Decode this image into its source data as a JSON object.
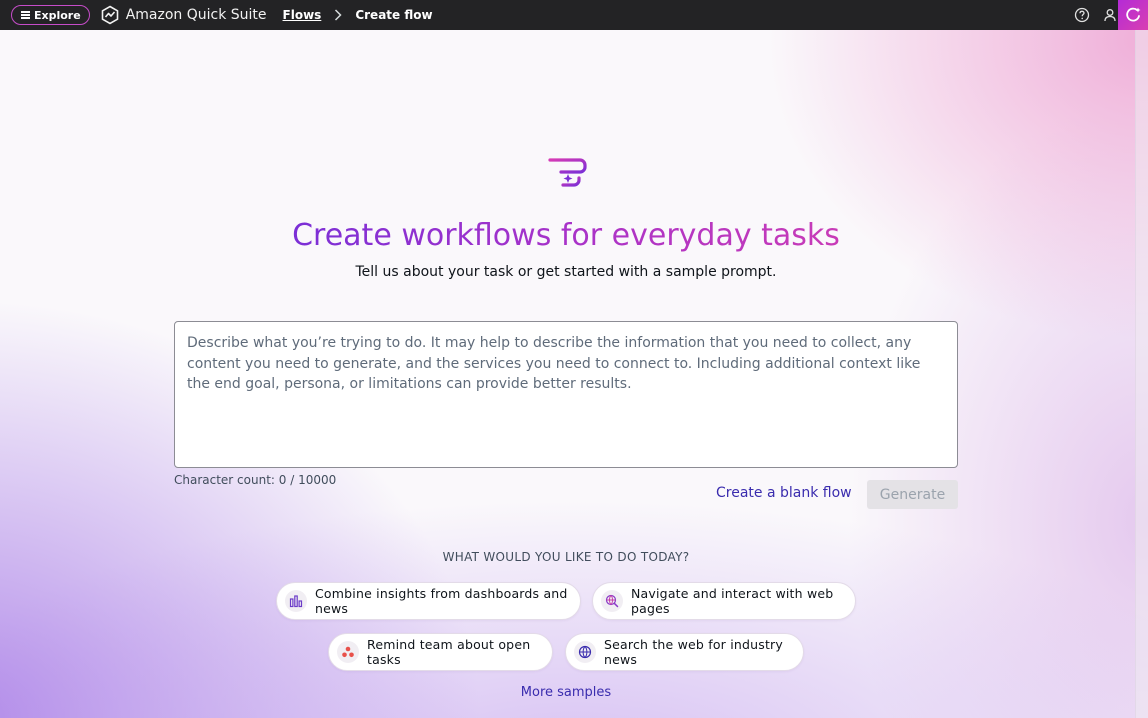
{
  "topbar": {
    "explore_label": "Explore",
    "app_name": "Amazon Quick Suite",
    "breadcrumb": {
      "parent": "Flows",
      "current": "Create flow"
    }
  },
  "hero": {
    "title": "Create workflows for everyday tasks",
    "subtitle": "Tell us about your task or get started with a sample prompt."
  },
  "prompt": {
    "placeholder": "Describe what you’re trying to do. It may help to describe the information that you need to collect, any content you need to generate, and the services you need to connect to. Including additional context like the end goal, persona, or limitations can provide better results.",
    "value": "",
    "char_count": "Character count: 0 / 10000"
  },
  "actions": {
    "blank_flow": "Create a blank flow",
    "generate": "Generate"
  },
  "samples": {
    "heading": "WHAT WOULD YOU LIKE TO DO TODAY?",
    "items": [
      {
        "label": "Combine insights from dashboards and news",
        "icon": "bar-chart-icon"
      },
      {
        "label": "Navigate and interact with web pages",
        "icon": "web-search-icon"
      },
      {
        "label": "Remind team about open tasks",
        "icon": "team-icon"
      },
      {
        "label": "Search the web for industry news",
        "icon": "globe-icon"
      }
    ],
    "more": "More samples"
  },
  "colors": {
    "topbar_bg": "#232325",
    "accent": "#3a2cae",
    "title_gradient_start": "#7b2fd6",
    "title_gradient_end": "#c83bb7"
  }
}
